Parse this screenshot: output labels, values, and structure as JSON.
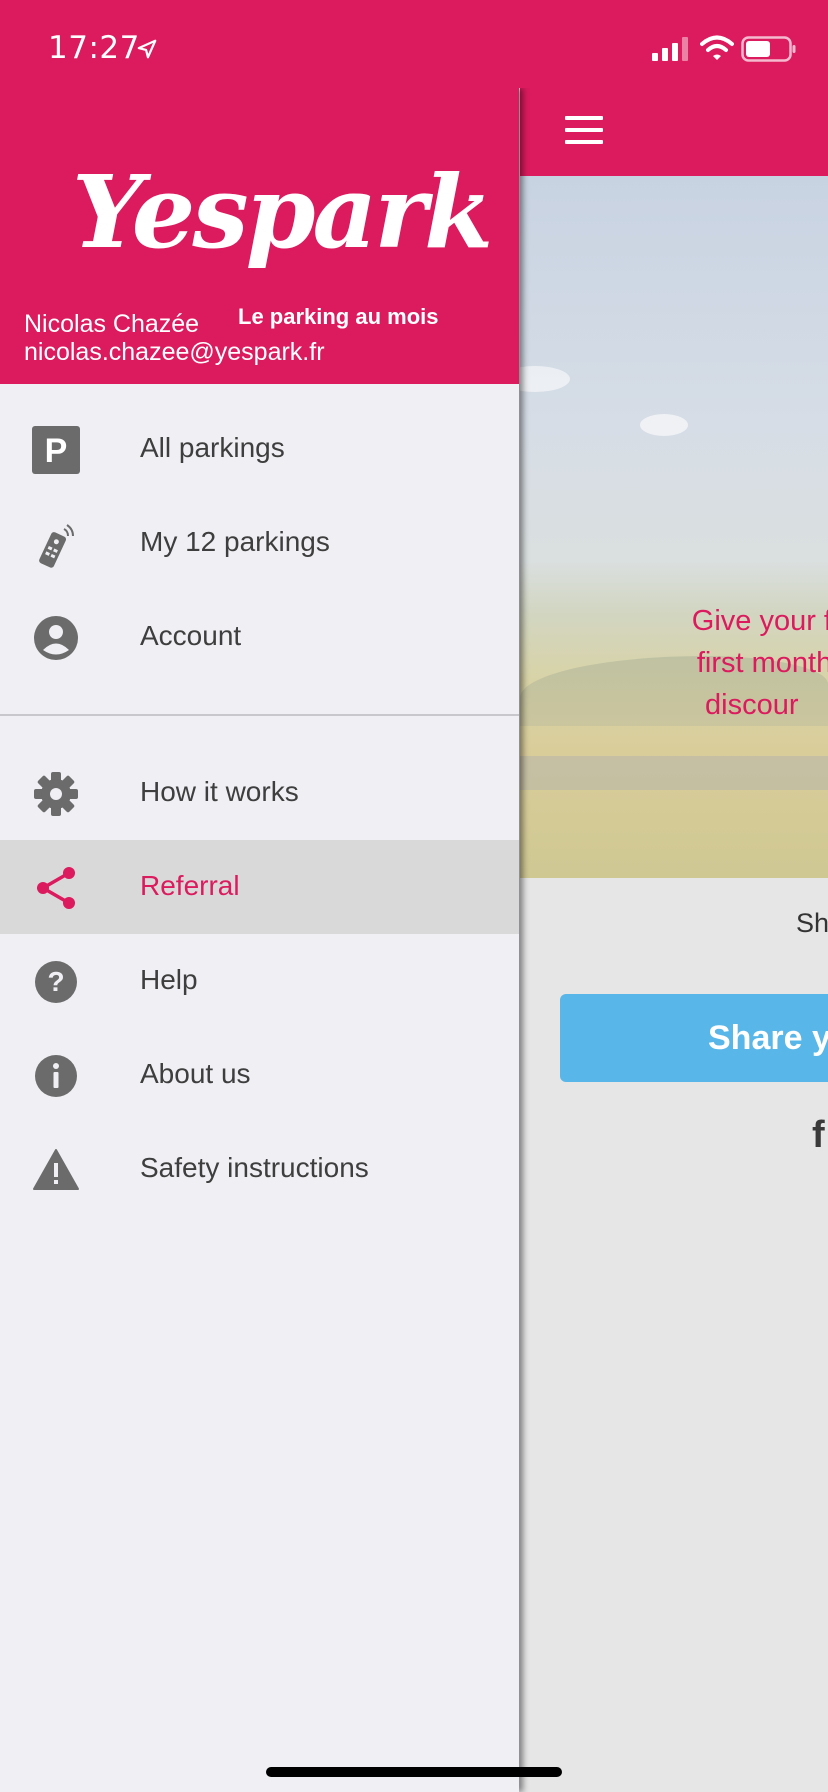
{
  "status_bar": {
    "time": "17:27"
  },
  "drawer": {
    "logo_text": "Yespark",
    "tagline": "Le parking au mois",
    "user_name": "Nicolas Chazée",
    "user_email": "nicolas.chazee@yespark.fr",
    "primary_items": [
      {
        "label": "All parkings",
        "icon": "parking-icon"
      },
      {
        "label": "My 12 parkings",
        "icon": "remote-icon"
      },
      {
        "label": "Account",
        "icon": "account-icon"
      }
    ],
    "secondary_items": [
      {
        "label": "How it works",
        "icon": "gear-icon"
      },
      {
        "label": "Referral",
        "icon": "share-icon",
        "active": true
      },
      {
        "label": "Help",
        "icon": "help-icon"
      },
      {
        "label": "About us",
        "icon": "info-icon"
      },
      {
        "label": "Safety instructions",
        "icon": "warning-icon"
      }
    ]
  },
  "background": {
    "hero_lines": [
      "Give your frie",
      "first monthly",
      "discour"
    ],
    "share_caption": "Sh",
    "share_button": "Share y",
    "facebook_glyph": "f"
  },
  "colors": {
    "brand": "#dc1a5e",
    "share_button": "#58b7e8",
    "icon_gray": "#6b6b6b"
  }
}
